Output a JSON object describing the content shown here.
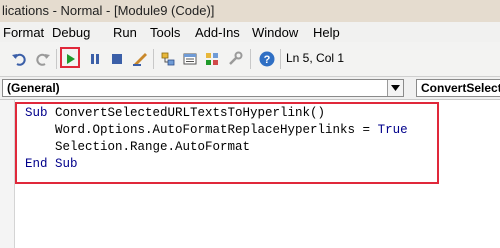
{
  "window": {
    "title": "lications - Normal - [Module9 (Code)]"
  },
  "menu": [
    "Format",
    "Debug",
    "Run",
    "Tools",
    "Add-Ins",
    "Window",
    "Help"
  ],
  "toolbar": {
    "icons": [
      "undo-icon",
      "redo-icon",
      "run-icon",
      "break-icon",
      "reset-icon",
      "design-mode-icon",
      "project-explorer-icon",
      "properties-window-icon",
      "object-browser-icon",
      "toolbox-icon",
      "help-icon"
    ],
    "status": "Ln 5, Col 1"
  },
  "combos": {
    "object": "(General)",
    "procedure": "ConvertSelecte"
  },
  "code": {
    "line1": {
      "kw": "Sub",
      "text": " ConvertSelectedURLTextsToHyperlink()"
    },
    "line2": {
      "text": "    Word.Options.AutoFormatReplaceHyperlinks = ",
      "kw": "True"
    },
    "line3": {
      "text": "    Selection.Range.AutoFormat"
    },
    "line4": {
      "kw": "End Sub"
    }
  },
  "colors": {
    "highlight": "#e0283a",
    "keyword": "#00008b",
    "run_green": "#1f9a2a"
  }
}
